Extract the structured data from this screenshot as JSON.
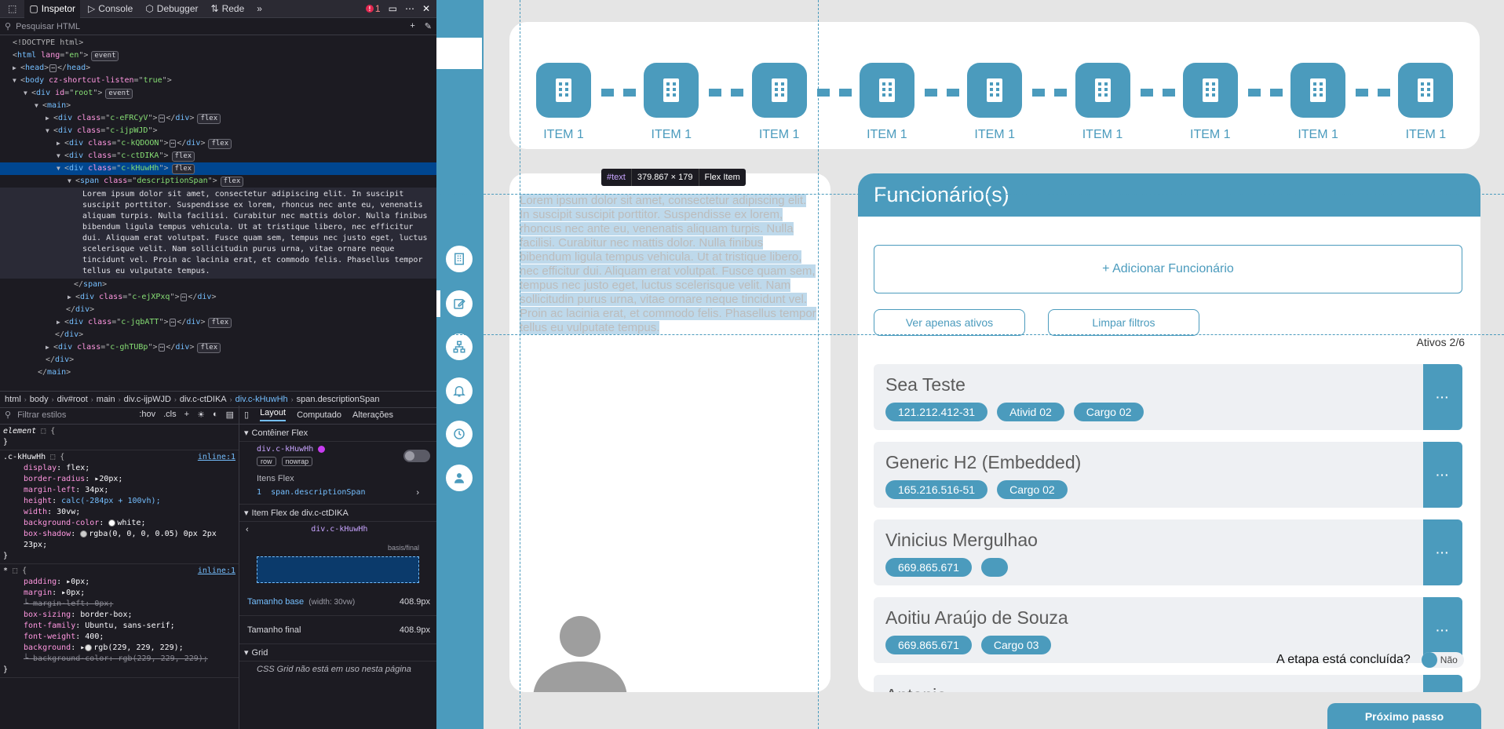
{
  "devtools": {
    "tabs": [
      {
        "label": "Inspetor",
        "icon": "inspector-icon"
      },
      {
        "label": "Console",
        "icon": "console-icon"
      },
      {
        "label": "Debugger",
        "icon": "debugger-icon"
      },
      {
        "label": "Rede",
        "icon": "network-icon"
      }
    ],
    "error_count": "1",
    "search_placeholder": "Pesquisar HTML",
    "dom": {
      "doctype": "<!DOCTYPE html>",
      "html_open": "html",
      "html_lang": "en",
      "head": "head",
      "body_attr": "cz-shortcut-listen",
      "body_attr_val": "true",
      "root_id": "root",
      "main": "main",
      "classes": [
        "c-eFRCyV",
        "c-ijpWJD",
        "c-kQDOON",
        "c-ctDIKA",
        "c-kHuwHh",
        "descriptionSpan",
        "c-ejXPxq",
        "c-jqbATT",
        "c-ghTUBp"
      ],
      "text_node": "Lorem ipsum dolor sit amet, consectetur adipiscing elit. In suscipit suscipit porttitor. Suspendisse ex lorem, rhoncus nec ante eu, venenatis aliquam turpis. Nulla facilisi. Curabitur nec mattis dolor. Nulla finibus bibendum ligula tempus vehicula. Ut at tristique libero, nec efficitur dui. Aliquam erat volutpat. Fusce quam sem, tempus nec justo eget, luctus scelerisque velit. Nam sollicitudin purus urna, vitae ornare neque tincidunt vel. Proin ac lacinia erat, et commodo felis. Phasellus tempor tellus eu vulputate tempus.",
      "event_badge": "event",
      "flex_badge": "flex"
    },
    "breadcrumbs": [
      "html",
      "body",
      "div#root",
      "main",
      "div.c-ijpWJD",
      "div.c-ctDIKA",
      "div.c-kHuwHh",
      "span.descriptionSpan"
    ],
    "rules": {
      "filter_placeholder": "Filtrar estilos",
      "hov": ":hov",
      "cls": ".cls",
      "element_sel": "element",
      "rule1_sel": ".c-kHuwHh",
      "rule1_src": "inline:1",
      "rule1_props": [
        {
          "name": "display",
          "val": "flex;"
        },
        {
          "name": "border-radius",
          "val": "20px;"
        },
        {
          "name": "margin-left",
          "val": "34px;"
        },
        {
          "name": "height",
          "val": "calc(-284px + 100vh);"
        },
        {
          "name": "width",
          "val": "30vw;"
        },
        {
          "name": "background-color",
          "val": "white;"
        },
        {
          "name": "box-shadow",
          "val": "rgba(0, 0, 0, 0.05) 0px 2px 23px;"
        }
      ],
      "rule2_sel": "*",
      "rule2_src": "inline:1",
      "rule2_props": [
        {
          "name": "padding",
          "val": "0px;"
        },
        {
          "name": "margin",
          "val": "0px;"
        },
        {
          "name": "margin-left",
          "val": "0px;",
          "struck": true
        },
        {
          "name": "box-sizing",
          "val": "border-box;"
        },
        {
          "name": "font-family",
          "val": "Ubuntu, sans-serif;"
        },
        {
          "name": "font-weight",
          "val": "400;"
        },
        {
          "name": "background",
          "val": "rgb(229, 229, 229);"
        },
        {
          "name": "background-color",
          "val": "rgb(229, 229, 229);",
          "struck": true
        }
      ]
    },
    "layout": {
      "tabs": [
        "Layout",
        "Computado",
        "Alterações"
      ],
      "flex_container": "Contêiner Flex",
      "flex_container_sel": "div.c-kHuwHh",
      "direction_pills": [
        "row",
        "nowrap"
      ],
      "flex_items": "Itens Flex",
      "flex_item_index": "1",
      "flex_item_sel": "span.descriptionSpan",
      "flex_item_of": "Item Flex de div.c-ctDIKA",
      "flex_item_nav": "div.c-kHuwHh",
      "basis_label": "basis/final",
      "base_size_label": "Tamanho base",
      "base_size_note": "(width: 30vw)",
      "base_size_val": "408.9px",
      "final_size_label": "Tamanho final",
      "final_size_val": "408.9px",
      "grid_label": "Grid",
      "grid_msg": "CSS Grid não está em uso nesta página"
    }
  },
  "app": {
    "accent": "#4b9bbd",
    "steps": [
      "ITEM 1",
      "ITEM 1",
      "ITEM 1",
      "ITEM 1",
      "ITEM 1",
      "ITEM 1",
      "ITEM 1",
      "ITEM 1",
      "ITEM 1"
    ],
    "description": "Lorem ipsum dolor sit amet, consectetur adipiscing elit. In suscipit suscipit porttitor. Suspendisse ex lorem, rhoncus nec ante eu, venenatis aliquam turpis. Nulla facilisi. Curabitur nec mattis dolor. Nulla finibus bibendum ligula tempus vehicula. Ut at tristique libero, nec efficitur dui. Aliquam erat volutpat. Fusce quam sem, tempus nec justo eget, luctus scelerisque velit. Nam sollicitudin purus urna, vitae ornare neque tincidunt vel. Proin ac lacinia erat, et commodo felis. Phasellus tempor tellus eu vulputate tempus.",
    "tooltip": {
      "node": "#text",
      "size": "379.867 × 179",
      "kind": "Flex Item"
    },
    "employees_title": "Funcionário(s)",
    "add_employee": "+ Adicionar Funcionário",
    "filter_active": "Ver apenas ativos",
    "clear_filters": "Limpar filtros",
    "active_count": "Ativos 2/6",
    "employees": [
      {
        "name": "Sea Teste",
        "tags": [
          "121.212.412-31",
          "Ativid 02",
          "Cargo 02"
        ]
      },
      {
        "name": "Generic H2 (Embedded)",
        "tags": [
          "165.216.516-51",
          "Cargo 02"
        ]
      },
      {
        "name": "Vinicius Mergulhao",
        "tags": [
          "669.865.671",
          ""
        ]
      },
      {
        "name": "Aoitiu Araújo de Souza",
        "tags": [
          "669.865.671",
          "Cargo 03"
        ]
      },
      {
        "name": "Antonio",
        "tags": []
      }
    ],
    "more_label": "···",
    "step_done_label": "A etapa está concluída?",
    "step_done_value": "Não",
    "next_button": "Próximo passo",
    "sidebar_icons": [
      "building-icon",
      "edit-icon",
      "org-chart-icon",
      "bell-icon",
      "history-icon",
      "user-icon"
    ]
  }
}
